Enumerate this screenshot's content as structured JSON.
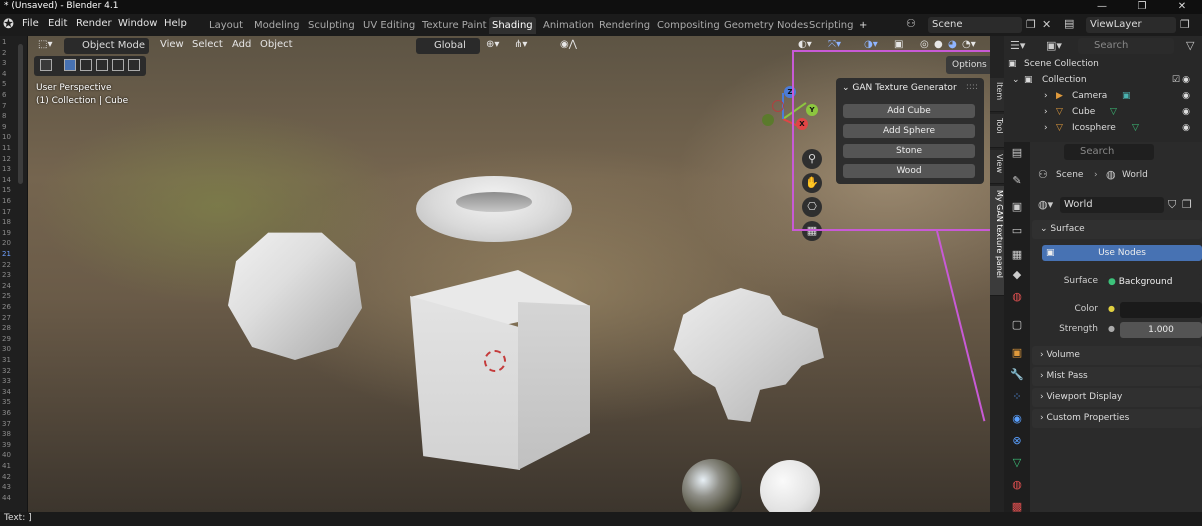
{
  "window": {
    "title": "* (Unsaved) - Blender 4.1",
    "minimize": "—",
    "maximize": "❐",
    "close": "✕"
  },
  "menu": {
    "items": [
      "File",
      "Edit",
      "Render",
      "Window",
      "Help"
    ],
    "workspaces": [
      "Layout",
      "Modeling",
      "Sculpting",
      "UV Editing",
      "Texture Paint",
      "Shading",
      "Animation",
      "Rendering",
      "Compositing",
      "Geometry Nodes",
      "Scripting"
    ],
    "active_workspace": "Shading",
    "add_workspace": "+",
    "scene_name": "Scene",
    "view_layer": "ViewLayer"
  },
  "viewport_header": {
    "mode": "Object Mode",
    "menus": [
      "View",
      "Select",
      "Add",
      "Object"
    ],
    "orientation": "Global"
  },
  "viewport_overlay": {
    "perspective": "User Perspective",
    "collection_info": "(1) Collection | Cube"
  },
  "gizmo": {
    "x": "X",
    "y": "Y",
    "z": "Z"
  },
  "options_label": "Options",
  "gan_panel": {
    "title": "GAN Texture Generator",
    "buttons": [
      "Add Cube",
      "Add Sphere",
      "Stone",
      "Wood"
    ]
  },
  "sidebar_tabs": [
    "Item",
    "Tool",
    "View",
    "My GAN texture panel"
  ],
  "active_sidebar_tab": "My GAN texture panel",
  "outliner": {
    "search_placeholder": "Search",
    "rows": [
      "Scene Collection",
      "Collection",
      "Camera",
      "Cube",
      "Icosphere"
    ]
  },
  "properties": {
    "search_placeholder": "Search",
    "breadcrumb_scene": "Scene",
    "breadcrumb_world": "World",
    "world_name": "World",
    "surface_section": "Surface",
    "use_nodes": "Use Nodes",
    "surface_label": "Surface",
    "surface_value": "Background",
    "color_label": "Color",
    "strength_label": "Strength",
    "strength_value": "1.000",
    "sections": [
      "Volume",
      "Mist Pass",
      "Viewport Display",
      "Custom Properties"
    ]
  },
  "statusbar": {
    "text": "Text: ]"
  },
  "ruler_lines": [
    "1",
    "2",
    "3",
    "4",
    "5",
    "6",
    "7",
    "8",
    "9",
    "10",
    "11",
    "12",
    "13",
    "14",
    "15",
    "16",
    "17",
    "18",
    "19",
    "20",
    "21",
    "22",
    "23",
    "24",
    "25",
    "26",
    "27",
    "28",
    "29",
    "30",
    "31",
    "32",
    "33",
    "34",
    "35",
    "36",
    "37",
    "38",
    "39",
    "40",
    "41",
    "42",
    "43",
    "44"
  ],
  "ruler_highlight": "21",
  "colors": {
    "highlight_box": "#c85ad6",
    "accent_blue": "#4772b3",
    "axis_x": "#e04545",
    "axis_y": "#8cc63f",
    "axis_z": "#4b7bd8"
  }
}
